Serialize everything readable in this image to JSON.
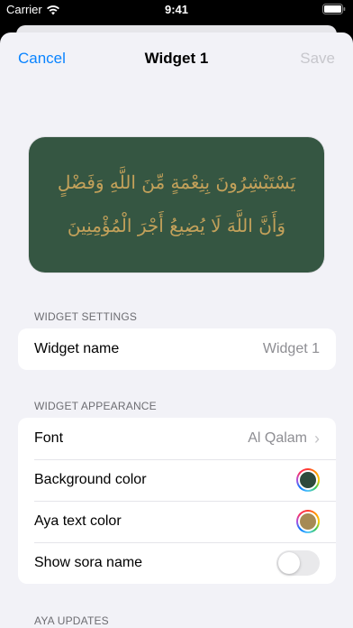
{
  "status": {
    "carrier": "Carrier",
    "time": "9:41"
  },
  "nav": {
    "cancel": "Cancel",
    "title": "Widget 1",
    "save": "Save"
  },
  "preview": {
    "line1": "يَسْتَبْشِرُونَ بِنِعْمَةٍ مِّنَ اللَّهِ وَفَضْلٍ",
    "line2": "وَأَنَّ اللَّهَ لَا يُضِيعُ أَجْرَ الْمُؤْمِنِينَ",
    "background": "#355642",
    "text_color": "#c3a15a"
  },
  "settings": {
    "header": "WIDGET SETTINGS",
    "name_label": "Widget name",
    "name_value": "Widget 1"
  },
  "appearance": {
    "header": "WIDGET APPEARANCE",
    "font_label": "Font",
    "font_value": "Al Qalam",
    "bg_label": "Background color",
    "bg_color": "#2e4a3c",
    "text_label": "Aya text color",
    "text_color": "#a68a55",
    "sora_label": "Show sora name",
    "sora_on": false
  },
  "updates": {
    "header": "AYA UPDATES"
  }
}
